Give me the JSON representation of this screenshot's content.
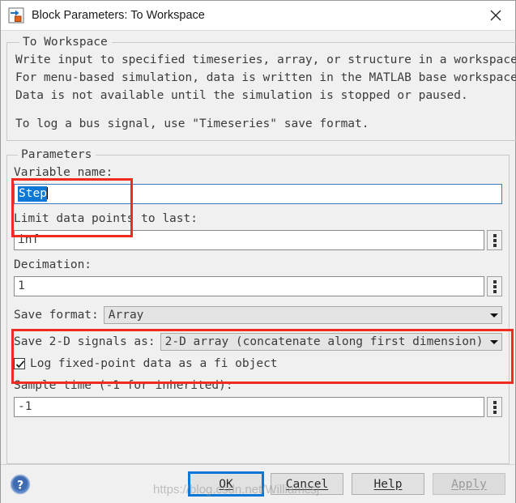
{
  "window": {
    "title": "Block Parameters: To Workspace",
    "icon": "simulink-block-icon",
    "close_label": "×"
  },
  "description": {
    "legend": "To Workspace",
    "lines": [
      "Write input to specified timeseries, array, or structure in a workspace.",
      "For menu-based simulation, data is written in the MATLAB base workspace.",
      "Data is not available until the simulation is stopped or paused.",
      "To log a bus signal, use \"Timeseries\" save format."
    ]
  },
  "parameters": {
    "legend": "Parameters",
    "variable_name": {
      "label": "Variable name:",
      "value": "Step",
      "selected": true
    },
    "limit_data_points": {
      "label": "Limit data points to last:",
      "value": "inf"
    },
    "decimation": {
      "label": "Decimation:",
      "value": "1"
    },
    "save_format": {
      "label": "Save format:",
      "value": "Array"
    },
    "save_2d_signals": {
      "label": "Save 2-D signals as:",
      "value": "2-D array (concatenate along first dimension)"
    },
    "log_fixed_point": {
      "label": "Log fixed-point data as a fi object",
      "checked": true
    },
    "sample_time": {
      "label": "Sample time (-1 for inherited):",
      "value": "-1"
    }
  },
  "annotations": {
    "color": "#f22b20",
    "boxes": [
      "variable-name-highlight",
      "save-format-highlight"
    ]
  },
  "footer": {
    "help_icon": "question-mark-icon",
    "buttons": [
      {
        "label": "OK",
        "mnemonic": "O",
        "default": true,
        "disabled": false
      },
      {
        "label": "Cancel",
        "mnemonic": "C",
        "default": false,
        "disabled": false
      },
      {
        "label": "Help",
        "mnemonic": "H",
        "default": false,
        "disabled": false
      },
      {
        "label": "Apply",
        "mnemonic": "A",
        "default": false,
        "disabled": true
      }
    ]
  },
  "watermark": "https://blog.csdn.net/Williamcsj"
}
